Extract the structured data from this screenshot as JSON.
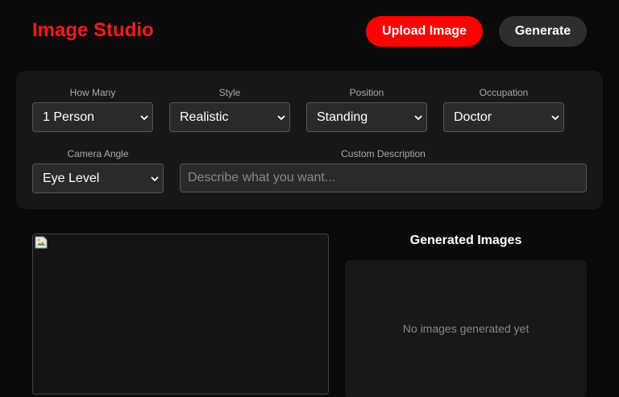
{
  "header": {
    "title": "Image Studio",
    "upload_label": "Upload Image",
    "generate_label": "Generate"
  },
  "controls": {
    "how_many": {
      "label": "How Many",
      "value": "1 Person"
    },
    "style": {
      "label": "Style",
      "value": "Realistic"
    },
    "position": {
      "label": "Position",
      "value": "Standing"
    },
    "occupation": {
      "label": "Occupation",
      "value": "Doctor"
    },
    "camera_angle": {
      "label": "Camera Angle",
      "value": "Eye Level"
    },
    "custom_description": {
      "label": "Custom Description",
      "placeholder": "Describe what you want..."
    }
  },
  "preview": {
    "icon": "broken-image-icon"
  },
  "generated": {
    "title": "Generated Images",
    "empty_text": "No images generated yet"
  },
  "colors": {
    "accent": "#ff0000",
    "title_red": "#ff1a1a",
    "background": "#0a0a0a",
    "panel": "#171717"
  }
}
